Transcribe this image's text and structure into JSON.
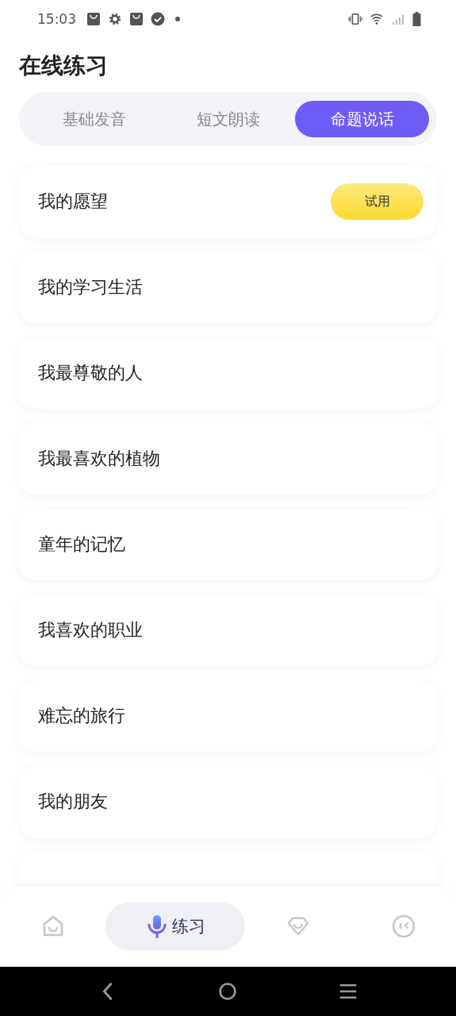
{
  "status_bar": {
    "time": "15:03"
  },
  "title": "在线练习",
  "tabs": [
    {
      "label": "基础发音",
      "selected": false
    },
    {
      "label": "短文朗读",
      "selected": false
    },
    {
      "label": "命题说话",
      "selected": true
    }
  ],
  "topics": [
    {
      "title": "我的愿望",
      "badge": "试用"
    },
    {
      "title": "我的学习生活"
    },
    {
      "title": "我最尊敬的人"
    },
    {
      "title": "我最喜欢的植物"
    },
    {
      "title": "童年的记忆"
    },
    {
      "title": "我喜欢的职业"
    },
    {
      "title": "难忘的旅行"
    },
    {
      "title": "我的朋友"
    }
  ],
  "bottom_nav": [
    {
      "kind": "home",
      "selected": false
    },
    {
      "kind": "practice",
      "label": "练习",
      "selected": true
    },
    {
      "kind": "gem",
      "selected": false
    },
    {
      "kind": "face",
      "selected": false
    }
  ]
}
